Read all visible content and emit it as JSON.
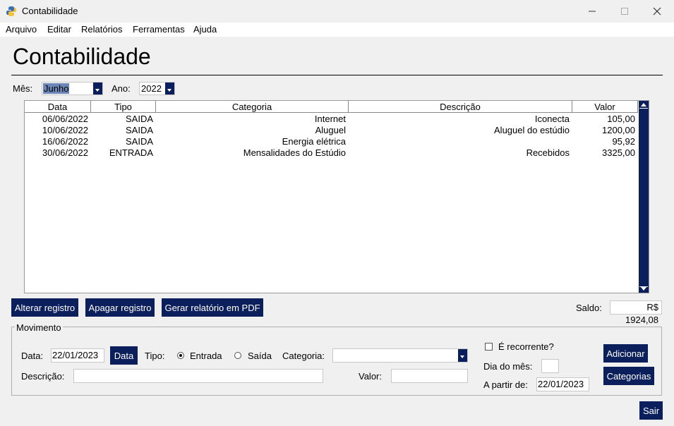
{
  "window": {
    "title": "Contabilidade",
    "minimize_icon": "minimize-icon",
    "maximize_icon": "maximize-icon",
    "close_icon": "close-icon"
  },
  "menu": [
    "Arquivo",
    "Editar",
    "Relatórios",
    "Ferramentas",
    "Ajuda"
  ],
  "header": {
    "title": "Contabilidade"
  },
  "filters": {
    "month_label": "Mês:",
    "month_value": "Junho",
    "year_label": "Ano:",
    "year_value": "2022"
  },
  "table": {
    "columns": [
      "Data",
      "Tipo",
      "Categoria",
      "Descrição",
      "Valor"
    ],
    "rows": [
      [
        "06/06/2022",
        "SAIDA",
        "Internet",
        "Iconecta",
        "105,00"
      ],
      [
        "10/06/2022",
        "SAIDA",
        "Aluguel",
        "Aluguel do estúdio",
        "1200,00"
      ],
      [
        "16/06/2022",
        "SAIDA",
        "Energia elétrica",
        "",
        "95,92"
      ],
      [
        "30/06/2022",
        "ENTRADA",
        "Mensalidades do Estúdio",
        "Recebidos",
        "3325,00"
      ]
    ]
  },
  "actions": {
    "edit": "Alterar registro",
    "delete": "Apagar registro",
    "pdf": "Gerar relatório em PDF",
    "balance_label": "Saldo:",
    "balance_value": "R$ 1924,08"
  },
  "movement": {
    "group_title": "Movimento",
    "date_label": "Data:",
    "date_value": "22/01/2023",
    "date_button": "Data",
    "type_label": "Tipo:",
    "type_in": "Entrada",
    "type_out": "Saída",
    "type_selected": "Entrada",
    "category_label": "Categoria:",
    "category_value": "",
    "description_label": "Descrição:",
    "description_value": "",
    "value_label": "Valor:",
    "value_value": "",
    "recurring_label": "É recorrente?",
    "recurring_checked": false,
    "day_label": "Dia do mês:",
    "day_value": "",
    "from_label": "A partir de:",
    "from_value": "22/01/2023",
    "add_button": "Adicionar",
    "categories_button": "Categorias"
  },
  "footer": {
    "exit_button": "Sair"
  },
  "colors": {
    "accent": "#0a1f5c",
    "button_text": "#ffffff",
    "background": "#f0f0f0"
  }
}
